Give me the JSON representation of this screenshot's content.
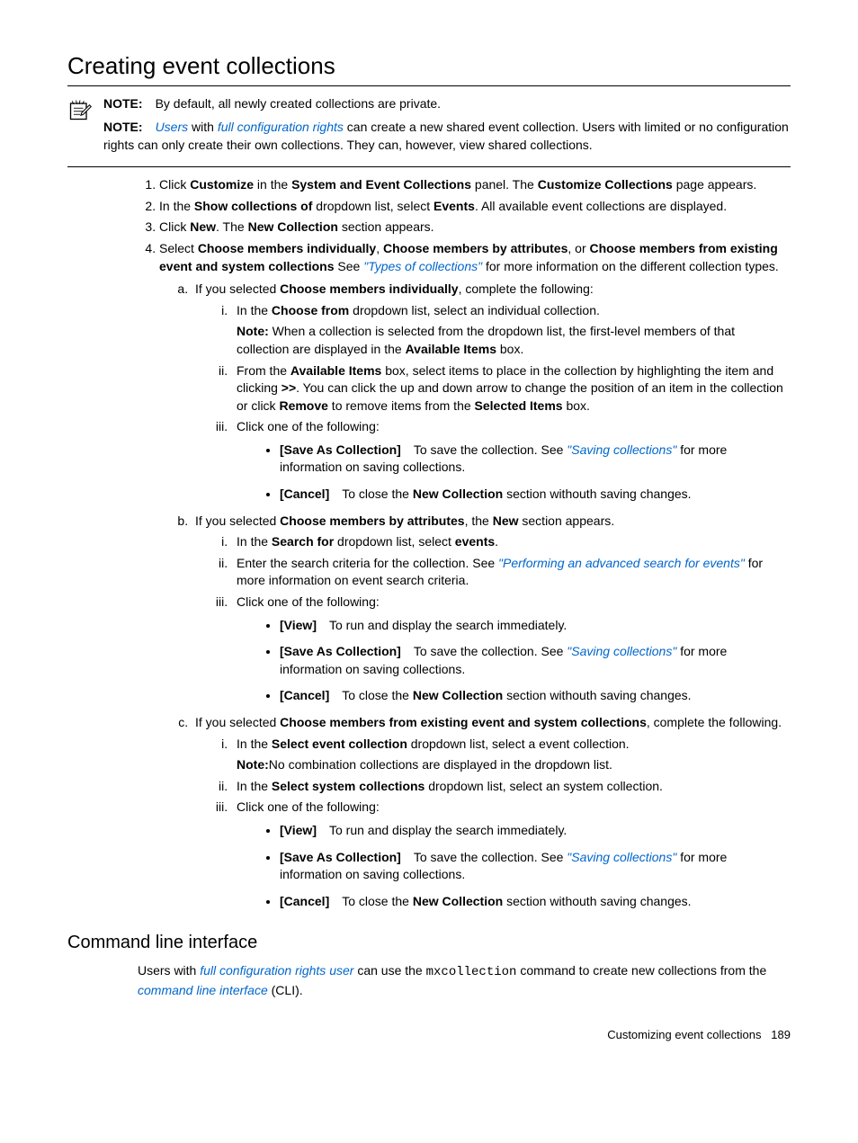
{
  "h1": "Creating event collections",
  "note1_label": "NOTE:",
  "note1_text": "By default, all newly created collections are private.",
  "note2_label": "NOTE:",
  "note2_link1": "Users",
  "note2_mid": " with ",
  "note2_link2": "full configuration rights",
  "note2_text": " can create a new shared event collection. Users with limited or no configuration rights can only create their own collections. They can, however, view shared collections.",
  "s1_a": "Click ",
  "s1_b": "Customize",
  "s1_c": " in the ",
  "s1_d": "System and Event Collections",
  "s1_e": " panel. The ",
  "s1_f": "Customize Collections",
  "s1_g": " page appears.",
  "s2_a": "In the ",
  "s2_b": "Show collections of",
  "s2_c": " dropdown list, select ",
  "s2_d": "Events",
  "s2_e": ". All available event collections are displayed.",
  "s3_a": "Click ",
  "s3_b": "New",
  "s3_c": ". The ",
  "s3_d": "New Collection",
  "s3_e": " section appears.",
  "s4_a": "Select ",
  "s4_b": "Choose members individually",
  "s4_c": ", ",
  "s4_d": "Choose members by attributes",
  "s4_e": ", or ",
  "s4_f": "Choose members from existing event and system collections",
  "s4_g": " See ",
  "s4_link": "\"Types of collections\"",
  "s4_h": " for more information on the different collection types.",
  "a_a": "If you selected ",
  "a_b": "Choose members individually",
  "a_c": ", complete the following:",
  "ai_a": "In the ",
  "ai_b": "Choose from",
  "ai_c": " dropdown list, select an individual collection.",
  "ai_note_a": "Note:",
  "ai_note_b": " When a collection is selected from the dropdown list, the first-level members of that collection are displayed in the ",
  "ai_note_c": "Available Items",
  "ai_note_d": " box.",
  "aii_a": "From the ",
  "aii_b": "Available Items",
  "aii_c": " box, select items to place in the collection by highlighting the item and clicking ",
  "aii_d": ">>",
  "aii_e": ". You can click the up and down arrow to change the position of an item in the collection or click ",
  "aii_f": "Remove",
  "aii_g": " to remove items from the ",
  "aii_h": "Selected Items",
  "aii_i": " box.",
  "aiii": "Click one of the following:",
  "save_label": "[Save As Collection]",
  "save_text_a": "To save the collection. See ",
  "save_link": "\"Saving collections\"",
  "save_text_b": " for more information on saving collections.",
  "cancel_label": "[Cancel]",
  "cancel_text_a": "To close the ",
  "cancel_bold": "New Collection",
  "cancel_text_b": " section withouth saving changes.",
  "b_a": "If you selected ",
  "b_b": "Choose members by attributes",
  "b_c": ", the ",
  "b_d": "New",
  "b_e": " section appears.",
  "bi_a": "In the ",
  "bi_b": "Search for",
  "bi_c": " dropdown list, select ",
  "bi_d": "events",
  "bi_e": ".",
  "bii_a": "Enter the search criteria for the collection. See ",
  "bii_link": "\"Performing an advanced search for events\"",
  "bii_b": " for more information on event search criteria.",
  "biii": "Click one of the following:",
  "view_label": "[View]",
  "view_text": "To run and display the search immediately.",
  "c_a": "If you selected ",
  "c_b": "Choose members from existing event and system collections",
  "c_c": ", complete the following.",
  "ci_a": "In the ",
  "ci_b": "Select event collection",
  "ci_c": " dropdown list, select a event collection.",
  "ci_note_a": "Note:",
  "ci_note_b": "No combination collections are displayed in the dropdown list.",
  "cii_a": "In the ",
  "cii_b": "Select system collections",
  "cii_c": " dropdown list, select an system collection.",
  "ciii": "Click one of the following:",
  "h2": "Command line interface",
  "cli_a": "Users with ",
  "cli_link1": "full configuration rights user",
  "cli_b": " can use the ",
  "cli_mono": "mxcollection",
  "cli_c": " command to create new collections from the ",
  "cli_link2": "command line interface",
  "cli_d": " (CLI).",
  "footer_a": "Customizing event collections",
  "footer_b": "189"
}
